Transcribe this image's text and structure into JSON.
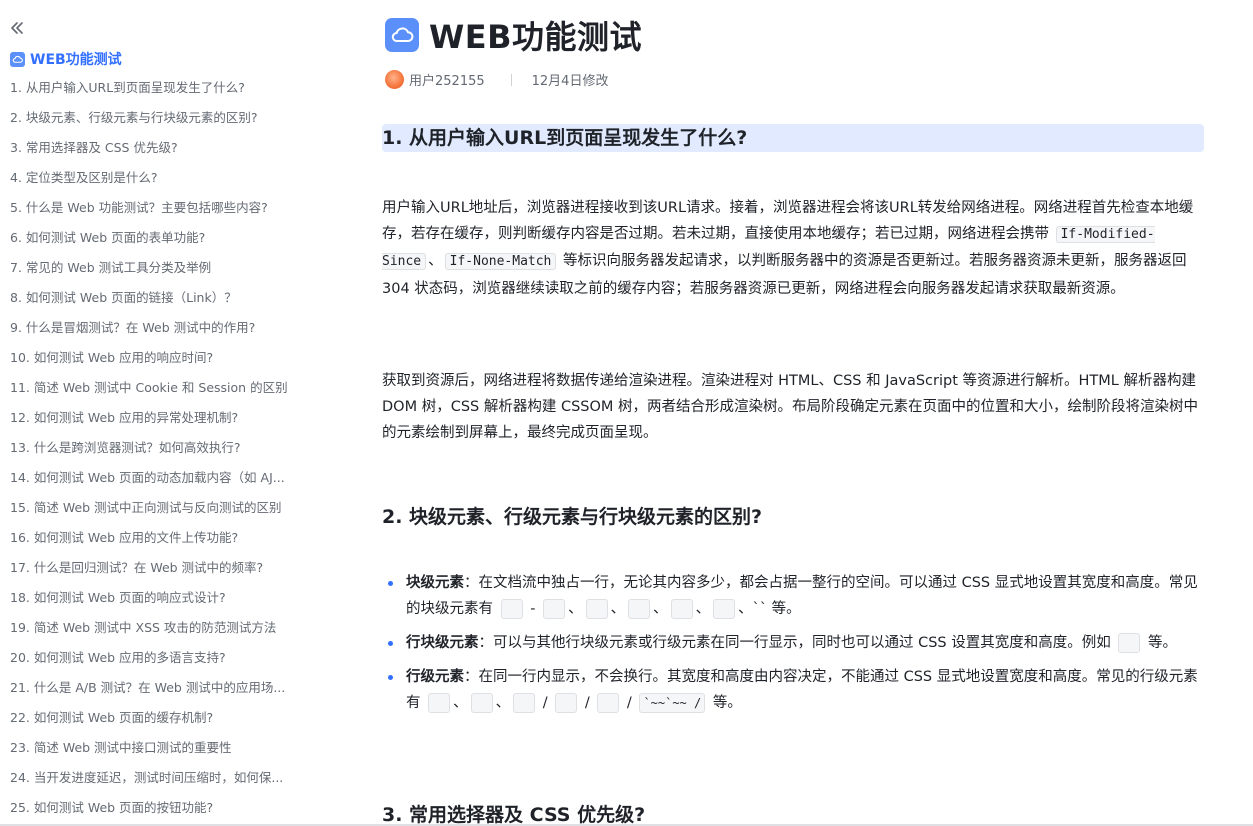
{
  "sidebar": {
    "title": "WEB功能测试",
    "items": [
      "1. 从用户输入URL到页面呈现发生了什么?",
      "2. 块级元素、行级元素与行块级元素的区别?",
      "3. 常用选择器及 CSS 优先级?",
      "4. 定位类型及区别是什么?",
      "5. 什么是 Web 功能测试？主要包括哪些内容?",
      "6. 如何测试 Web 页面的表单功能?",
      "7. 常见的 Web 测试工具分类及举例",
      "8. 如何测试 Web 页面的链接（Link）？",
      "9. 什么是冒烟测试？在 Web 测试中的作用?",
      "10. 如何测试 Web 应用的响应时间?",
      "11. 简述 Web 测试中 Cookie 和 Session 的区别",
      "12. 如何测试 Web 应用的异常处理机制?",
      "13. 什么是跨浏览器测试？如何高效执行?",
      "14. 如何测试 Web 页面的动态加载内容（如 AJ...",
      "15. 简述 Web 测试中正向测试与反向测试的区别",
      "16. 如何测试 Web 应用的文件上传功能?",
      "17. 什么是回归测试？在 Web 测试中的频率?",
      "18. 如何测试 Web 页面的响应式设计?",
      "19. 简述 Web 测试中 XSS 攻击的防范测试方法",
      "20. 如何测试 Web 应用的多语言支持?",
      "21. 什么是 A/B 测试？在 Web 测试中的应用场...",
      "22. 如何测试 Web 页面的缓存机制?",
      "23. 简述 Web 测试中接口测试的重要性",
      "24. 当开发进度延迟，测试时间压缩时，如何保...",
      "25. 如何测试 Web 页面的按钮功能?"
    ]
  },
  "doc": {
    "title": "WEB功能测试",
    "author": "用户252155",
    "modified": "12月4日修改",
    "section1_title": "1. 从用户输入URL到页面呈现发生了什么?",
    "p1_a": "用户输入URL地址后，浏览器进程接收到该URL请求。接着，浏览器进程会将该URL转发给网络进程。网络进程首先检查本地缓存，若存在缓存，则判断缓存内容是否过期。若未过期，直接使用本地缓存；若已过期，网络进程会携带 ",
    "code1": "If-Modified-Since",
    "p1_sep": "、",
    "code2": "If-None-Match",
    "p1_b": " 等标识向服务器发起请求，以判断服务器中的资源是否更新过。若服务器资源未更新，服务器返回 304 状态码，浏览器继续读取之前的缓存内容；若服务器资源已更新，网络进程会向服务器发起请求获取最新资源。",
    "p2": "获取到资源后，网络进程将数据传递给渲染进程。渲染进程对 HTML、CSS 和 JavaScript 等资源进行解析。HTML 解析器构建 DOM 树，CSS 解析器构建 CSSOM 树，两者结合形成渲染树。布局阶段确定元素在页面中的位置和大小，绘制阶段将渲染树中的元素绘制到屏幕上，最终完成页面呈现。",
    "section2_title": "2. 块级元素、行级元素与行块级元素的区别?",
    "b1_label": "块级元素",
    "b1_text_a": "：在文档流中独占一行，无论其内容多少，都会占据一整行的空间。可以通过 CSS 显式地设置其宽度和高度。常见的块级元素有 ",
    "b1_text_b": " 等。",
    "b2_label": "行块级元素",
    "b2_text_a": "：可以与其他行块级元素或行级元素在同一行显示，同时也可以通过 CSS 设置其宽度和高度。例如 ",
    "b2_text_b": " 等。",
    "b3_label": "行级元素",
    "b3_text_a": "：在同一行内显示，不会换行。其宽度和高度由内容决定，不能通过 CSS 显式地设置宽度和高度。常见的行级元素有 ",
    "b3_tag_last": "`~~`~~ /",
    "b3_text_b": " 等。",
    "section3_title": "3. 常用选择器及 CSS 优先级?"
  },
  "colors": {
    "accent": "#3370ff",
    "heading_bg": "#e1eaff"
  }
}
